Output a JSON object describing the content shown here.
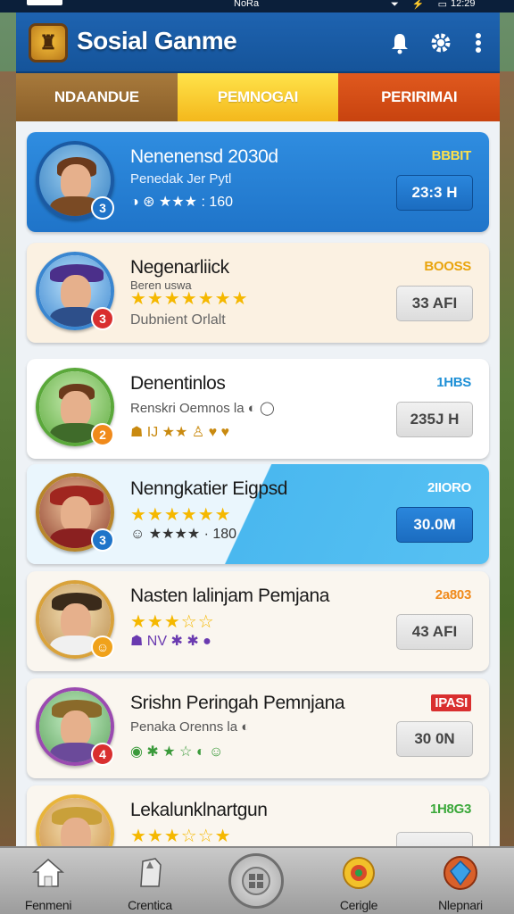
{
  "status_bar": {
    "carrier": "NoRa",
    "icons": "⏷ ⚡ ▭",
    "time": "12:29"
  },
  "app": {
    "title": "Sosial Ganme",
    "logo_icon": "game-logo-icon"
  },
  "header_icons": [
    {
      "name": "notification-bell-icon",
      "glyph": "🔔"
    },
    {
      "name": "settings-gear-icon",
      "glyph": "⚙"
    },
    {
      "name": "more-options-icon",
      "glyph": "⋮"
    }
  ],
  "tabs": [
    {
      "label": "NDAANDUE"
    },
    {
      "label": "PEMNOGAI"
    },
    {
      "label": "PERIRIMAI"
    }
  ],
  "players": [
    {
      "name": "Nenenensd 2030d",
      "sub": "Penedak Jer Pytl",
      "stats": "◑ ⊛ ★★★ : 160",
      "stars": "",
      "tag": "BBBIT",
      "tag_color": "#ffe14a",
      "value": "23:3 H",
      "level": "3",
      "level_color": "#1f74c9"
    },
    {
      "name": "Negenarliick",
      "sub": "Beren  uswa",
      "stats": "Dubnient Orlalt",
      "stars": "★★★★★★★",
      "tag": "BOOSS",
      "tag_color": "#e9a40d",
      "value": "33 AFI",
      "level": "3",
      "level_color": "#d92f2f"
    },
    {
      "name": "Denentinlos",
      "sub": "Renskri Oemnos la ◐ ◯",
      "stats": "☗ IJ ★★ ♙ ♥ ♥",
      "stars": "",
      "tag": "1HBS",
      "tag_color": "#1f90d6",
      "value": "235J H",
      "level": "2",
      "level_color": "#f08a1b"
    },
    {
      "name": "Nenngkatier Eigpsd",
      "sub": "",
      "stats": "☺ ★★★★ · 180",
      "stars": "★★★★★★",
      "tag": "2IIORO",
      "tag_color": "#ffffff",
      "value": "30.0M",
      "level": "3",
      "level_color": "#1f74c9"
    },
    {
      "name": "Nasten lalinjam Pemjana",
      "sub": "",
      "stats": "☗ NV  ✱ ✱ ●",
      "stars": "★★★☆☆",
      "tag": "2a803",
      "tag_color": "#f08a1b",
      "value": "43 AFI",
      "level": "☺",
      "level_color": "#f0a21b"
    },
    {
      "name": "Srishn Peringah Pemnjana",
      "sub": "Penaka Orenns la ◐",
      "stats": "◉ ✱ ★ ☆ ◐ ☺",
      "stars": "",
      "tag": "IPASI",
      "tag_color": "#d92f2f",
      "value": "30 0N",
      "level": "4",
      "level_color": "#d92f2f"
    },
    {
      "name": "Lekalunklnartgun",
      "sub": "",
      "stats": "",
      "stars": "★★★☆☆★",
      "tag": "1H8G3",
      "tag_color": "#3aa83a",
      "value": "",
      "level": "",
      "level_color": "#f0a21b"
    }
  ],
  "bottom_nav": [
    {
      "label": "Fenmeni",
      "icon": "home-icon",
      "glyph": "⌂"
    },
    {
      "label": "Crentica",
      "icon": "cards-icon",
      "glyph": "▱"
    },
    {
      "label": "",
      "icon": "center-action-icon",
      "glyph": "⊞"
    },
    {
      "label": "Cerigle",
      "icon": "treasure-icon",
      "glyph": "◉"
    },
    {
      "label": "Nlepnari",
      "icon": "gem-icon",
      "glyph": "◆"
    }
  ]
}
